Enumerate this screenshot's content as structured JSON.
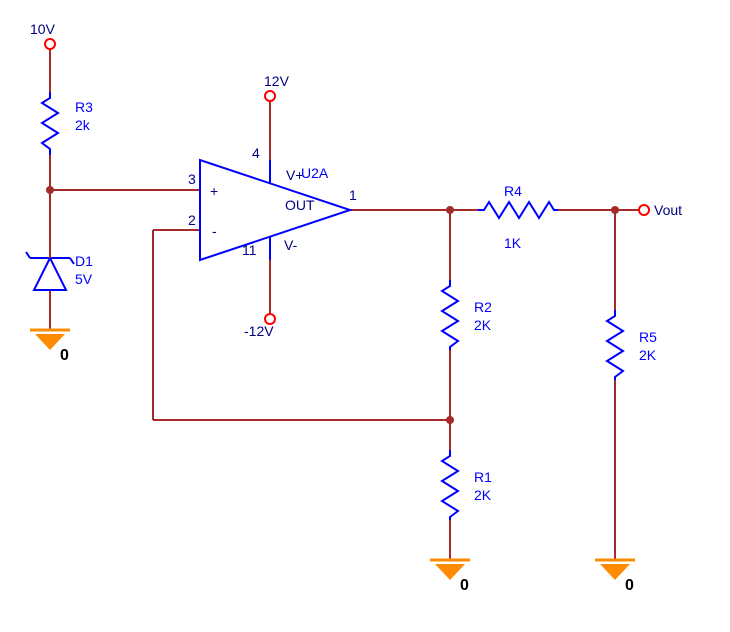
{
  "supplies": {
    "vin": "10V",
    "vpos": "12V",
    "vneg": "-12V"
  },
  "opamp": {
    "name": "U2A",
    "pin_noninv": "3",
    "pin_inv": "2",
    "pin_out": "1",
    "pin_vpos": "4",
    "pin_vneg": "11",
    "vpos_label": "V+",
    "vneg_label": "V-",
    "out_label": "OUT",
    "noninv_sym": "+",
    "inv_sym": "-"
  },
  "components": {
    "R1": {
      "name": "R1",
      "value": "2K"
    },
    "R2": {
      "name": "R2",
      "value": "2K"
    },
    "R3": {
      "name": "R3",
      "value": "2k"
    },
    "R4": {
      "name": "R4",
      "value": "1K"
    },
    "R5": {
      "name": "R5",
      "value": "2K"
    },
    "D1": {
      "name": "D1",
      "value": "5V"
    }
  },
  "output": {
    "label": "Vout"
  },
  "ground": {
    "label": "0"
  }
}
